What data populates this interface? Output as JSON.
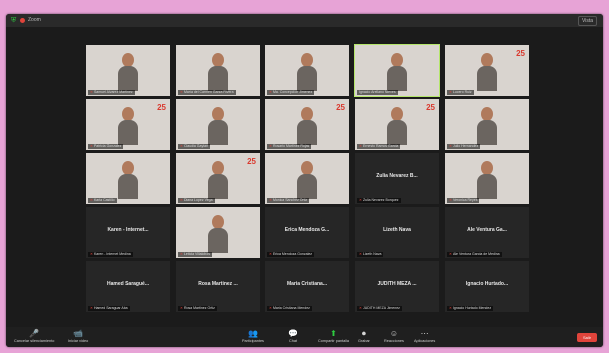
{
  "window": {
    "title": "Zoom",
    "view_label": "Vista"
  },
  "tiles": [
    {
      "label": "Samuel Alvarez Martinez",
      "name": "",
      "cam": true,
      "logo": "",
      "active": false,
      "muted": true
    },
    {
      "label": "María del Carmen Garza Rivera",
      "name": "",
      "cam": true,
      "logo": "",
      "active": false,
      "muted": true
    },
    {
      "label": "Ma. Concepcion Jimenez",
      "name": "",
      "cam": true,
      "logo": "",
      "active": false,
      "muted": true
    },
    {
      "label": "Ignacio Arellano Nieves",
      "name": "",
      "cam": true,
      "logo": "",
      "active": true,
      "muted": false
    },
    {
      "label": "Lucero Ruiz",
      "name": "",
      "cam": true,
      "logo": "25",
      "active": false,
      "muted": true
    },
    {
      "label": "Patricia Gonzalez",
      "name": "",
      "cam": true,
      "logo": "25",
      "active": false,
      "muted": true
    },
    {
      "label": "Claudia Gaytan",
      "name": "",
      "cam": true,
      "logo": "",
      "active": false,
      "muted": true
    },
    {
      "label": "Rosario Martinez Rojas",
      "name": "",
      "cam": true,
      "logo": "25",
      "active": false,
      "muted": true
    },
    {
      "label": "Ernesto Ramos Garcia",
      "name": "",
      "cam": true,
      "logo": "25",
      "active": false,
      "muted": true
    },
    {
      "label": "Julio Hernandez",
      "name": "",
      "cam": true,
      "logo": "",
      "active": false,
      "muted": true
    },
    {
      "label": "Karla Castillo",
      "name": "",
      "cam": true,
      "logo": "",
      "active": false,
      "muted": true
    },
    {
      "label": "Diana Lopez Vega",
      "name": "",
      "cam": true,
      "logo": "25",
      "active": false,
      "muted": true
    },
    {
      "label": "Monica Sanchez Ortiz",
      "name": "",
      "cam": true,
      "logo": "",
      "active": false,
      "muted": true
    },
    {
      "label": "Zulia Nevarez Borquez",
      "name": "Zulia Nevarez B...",
      "cam": false,
      "logo": "",
      "active": false,
      "muted": true
    },
    {
      "label": "Veronica Reyes",
      "name": "",
      "cam": true,
      "logo": "",
      "active": false,
      "muted": true
    },
    {
      "label": "Karen - Internet Medina",
      "name": "Karen - Internet...",
      "cam": false,
      "logo": "",
      "active": false,
      "muted": true
    },
    {
      "label": "Leticia Villalobos",
      "name": "",
      "cam": true,
      "logo": "",
      "active": false,
      "muted": true
    },
    {
      "label": "Erica Mendoza Gonzalez",
      "name": "Erica Mendoza G...",
      "cam": false,
      "logo": "",
      "active": false,
      "muted": true
    },
    {
      "label": "Lizeth Nava",
      "name": "Lizeth Nava",
      "cam": false,
      "logo": "",
      "active": false,
      "muted": true
    },
    {
      "label": "Ale Ventura Garcia de Medina",
      "name": "Ale Ventura Ga...",
      "cam": false,
      "logo": "",
      "active": false,
      "muted": true
    },
    {
      "label": "Hamed Saraguar Aba",
      "name": "Hamed Saragué...",
      "cam": false,
      "logo": "",
      "active": false,
      "muted": true
    },
    {
      "label": "Rosa Martinez Ortiz",
      "name": "Rosa Martinez ...",
      "cam": false,
      "logo": "",
      "active": false,
      "muted": true
    },
    {
      "label": "Maria Cristiana Mendez",
      "name": "Maria Cristiana...",
      "cam": false,
      "logo": "",
      "active": false,
      "muted": true
    },
    {
      "label": "JUDITH MEZA Jimenez",
      "name": "JUDITH MEZA ...",
      "cam": false,
      "logo": "",
      "active": false,
      "muted": true
    },
    {
      "label": "Ignacio Hurtado Mendez",
      "name": "Ignacio Hurtado...",
      "cam": false,
      "logo": "",
      "active": false,
      "muted": true
    }
  ],
  "toolbar": {
    "items": [
      {
        "icon": "🎤",
        "label": "Cancelar silenciamiento"
      },
      {
        "icon": "📹",
        "label": "Iniciar video"
      },
      {
        "icon": "👥",
        "label": "Participantes"
      },
      {
        "icon": "💬",
        "label": "Chat"
      },
      {
        "icon": "⬆",
        "label": "Compartir pantalla"
      },
      {
        "icon": "⏺",
        "label": "Grabar"
      },
      {
        "icon": "☺",
        "label": "Reacciones"
      },
      {
        "icon": "⋯",
        "label": "Aplicaciones"
      }
    ],
    "leave_label": "Salir"
  },
  "colors": {
    "accent": "#2ecc40",
    "leave": "#e0443b",
    "active_speaker": "#b5e66b",
    "brand_logo": "#d93a2f"
  }
}
